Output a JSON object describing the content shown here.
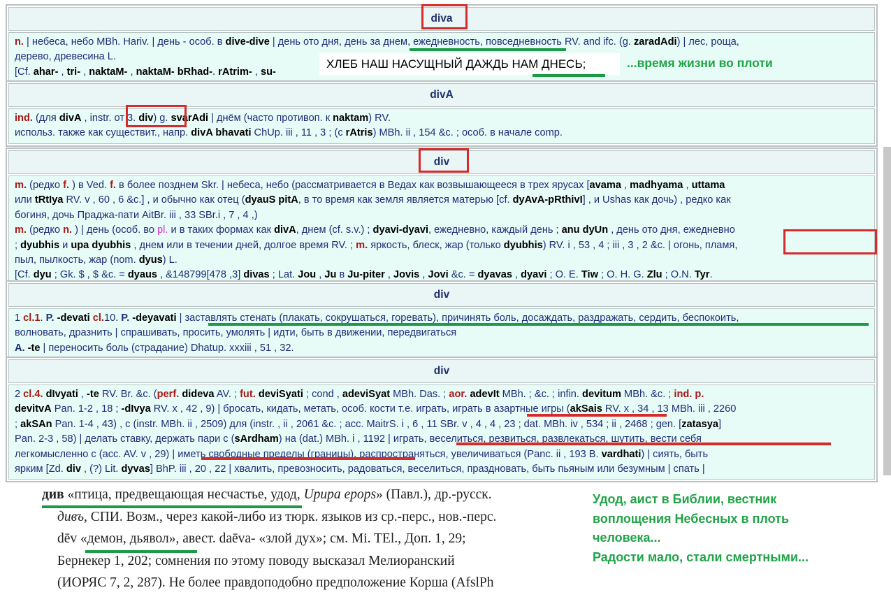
{
  "entries": [
    {
      "headword": "diva",
      "lines": [
        "<span class=\"gram\">n.</span> | небеса, небо MBh. Hariv. | день - особ. в <span class=\"skt\">dive-dive</span> | день ото дня, день за днем, ежедневность, повседневность RV. and ifc. (g. <span class=\"skt\">zaradAdi</span>) | лес, роща,",
        "дерево, древесина L.",
        "[Cf. <span class=\"skt\">ahar-</span> , <span class=\"skt\">tri-</span> , <span class=\"skt\">naktaM-</span> , <span class=\"skt\">naktaM- bRhad-</span>. <span class=\"skt\">rAtrim-</span> , <span class=\"skt\">su-</span>"
      ]
    },
    {
      "headword": "divA",
      "lines": [
        "<span class=\"gram\">ind.</span> (для <span class=\"skt\">divA</span> , instr. от 3. <span class=\"skt\">div</span>) g. <span class=\"skt\">svarAdi</span> | днём (часто противоп. к <span class=\"skt\">naktam</span>) RV.",
        "использ. также как существит., напр. <span class=\"skt\">divA bhavati</span> ChUp. iii , 11 , 3 ; (с <span class=\"skt\">rAtris</span>) MBh. ii , 154 &c. ; особ. в начале comp."
      ]
    },
    {
      "headword": "div",
      "lines": [
        "<span class=\"gram\">m.</span> (редко <span class=\"gram\">f.</span> ) в Ved. <span class=\"gram\">f.</span> в более позднем Skr. | небеса, небо (рассматривается в Ведах как возвышающееся в трех ярусах [<span class=\"skt\">avama</span> , <span class=\"skt\">madhyama</span> , <span class=\"skt\">uttama</span>",
        "или <span class=\"skt\">tRtIya</span> RV. v , 60 , 6 &c.] , и обычно как отец (<span class=\"skt\">dyauS pitA</span>, в то время как земля является матерью [cf. <span class=\"skt\">dyAvA-pRthivI</span>] , и Ushas как дочь) , редко как",
        "богиня, дочь Праджа-пати AitBr. iii , 33 SBr.i , 7 , 4 ,)",
        "<span class=\"gram\">m.</span> (редко <span class=\"gram\">n.</span> ) | день (особ. во <span class=\"pl\">pl.</span> и в таких формах как <span class=\"skt\">divA</span>, днем (cf. s.v.) ; <span class=\"skt\">dyavi-dyavi</span>, ежедневно, каждый день ; <span class=\"skt\">anu dyUn</span> , день ото дня, ежедневно",
        "; <span class=\"skt\">dyubhis</span> и <span class=\"skt\">upa dyubhis</span> , днем или в течении дней, долгое время RV. ; <span class=\"gram\">m.</span> яркость, блеск, жар (только <span class=\"skt\">dyubhis</span>) RV. i , 53 , 4 ; iii , 3 , 2 &c. | огонь, пламя,",
        "пыл, пылкость, жар (nom. <span class=\"skt\">dyus</span>) L.",
        "[Cf. <span class=\"skt\">dyu</span> ; Gk. $ , $ &c. = <span class=\"skt\">dyaus</span> , &148799[478 ,3] <span class=\"skt\">divas</span> ; Lat. <span class=\"skt\">Jou</span> , <span class=\"skt\">Ju</span> в <span class=\"skt\">Ju-piter</span> , <span class=\"skt\">Jovis</span> , <span class=\"skt\">Jovi</span> &c. = <span class=\"skt\">dyavas</span> , <span class=\"skt\">dyavi</span> ; O. E. <span class=\"skt\">Tiw</span> ; O. H. G. <span class=\"skt\">Zlu</span> ; O.N. <span class=\"skt\">Tyr</span>."
      ]
    },
    {
      "headword": "div",
      "lines": [
        "1 <span class=\"gram\">cl.1</span>. <span class=\"gram\" style=\"color:#1f2d78\">P.</span> <span class=\"skt\">-devati</span> <span class=\"gram\">cl.</span>10. <span class=\"gram\" style=\"color:#1f2d78\">P.</span> <span class=\"skt\">-deyavati</span> | заставлять стенать (плакать, сокрушаться, горевать), причинять боль, досаждать, раздражать, сердить, беспокоить,",
        "волновать, дразнить | спрашивать, просить, умолять | идти, быть в движении, передвигаться",
        "<span class=\"gram\" style=\"color:#1f2d78\">A.</span> <span class=\"skt\">-te</span> | переносить боль (страдание) Dhatup. xxxiii , 51 , 32."
      ]
    },
    {
      "headword": "div",
      "lines": [
        "2 <span class=\"gram\">cl.4.</span> <span class=\"skt\">dIvyati</span> , <span class=\"skt\">-te</span> RV. Br. &c. (<span class=\"gram\">perf.</span> <span class=\"skt\">dideva</span> AV. ; <span class=\"gram\">fut.</span> <span class=\"skt\">deviSyati</span> ; cond , <span class=\"skt\">adeviSyat</span> MBh. Das. ; <span class=\"gram\">aor.</span> <span class=\"skt\">adevIt</span> MBh. ; &c. ; infin. <span class=\"skt\">devitum</span> MBh. &c. ; <span class=\"gram\">ind. p.</span>",
        "<span class=\"skt\">devitvA</span> Pan. 1-2 , 18 ; <span class=\"skt\">-dIvya</span> RV. x , 42 , 9) | бросать, кидать, метать, особ. кости т.е. играть, играть в азартные игры (<span class=\"skt\">akSais</span> RV. x , 34 , 13 MBh. iii , 2260",
        "; <span class=\"skt\">akSAn</span> Pan. 1-4 , 43) , с (instr. MBh. ii , 2509) для (instr. , ii , 2061 &c. ; acc. MaitrS. i , 6 , 11 SBr. v , 4 , 4 , 23 ; dat. MBh. iv , 534 ; ii , 2468 ; gen. [<span class=\"skt\">zatasya</span>]",
        "Pan. 2-3 , 58) | делать ставку, держать пари с (<span class=\"skt\">sArdham</span>) на (dat.) MBh. i , 1192 | играть, веселиться, резвиться, развлекаться, шутить, вести себя",
        "легкомысленно с (acc. AV. v , 29) | иметь свободные пределы (границы), распространяться, увеличиваться (Panc. ii , 193 B. <span class=\"skt\">vardhati</span>) | сиять, быть",
        "ярким [Zd. <span class=\"skt\">div</span> , (?) Lit. <span class=\"skt\">dyvas</span>] BhP. iii , 20 , 22 | хвалить, превозносить, радоваться, веселиться, праздновать, быть пьяным или безумным | спать |"
      ]
    }
  ],
  "overlay_bread": "ХЛЕБ НАШ НАСУЩНЫЙ ДАЖДЬ НАМ ДНЕСЬ;",
  "note_time": "...время жизни во плоти",
  "note_hoopoe": [
    "Удод, аист в Библии, вестник",
    "воплощения Небесных в плоть",
    "человека...",
    "Радости мало, стали смертными..."
  ],
  "etymology": [
    "<b>див</b> «птица, предвещающая несчастье, удод, <i>Upupa epops</i>» (Павл.), др.-русск.",
    "<i>дивъ</i>, СПИ. Возм., через какой-либо из тюрк. языков из ср.-перс., нов.-перс.",
    "dēv «демон, дьявол», авест. daēva- «злой дух»; см. Mi. TEl., Доп. 1, 29;",
    "Бернекер 1, 202; сомнения по этому поводу высказал Мелиоранский",
    "(ИОРЯС 7, 2, 287). Не более правдоподобно предположение Корша (AfslPh"
  ]
}
